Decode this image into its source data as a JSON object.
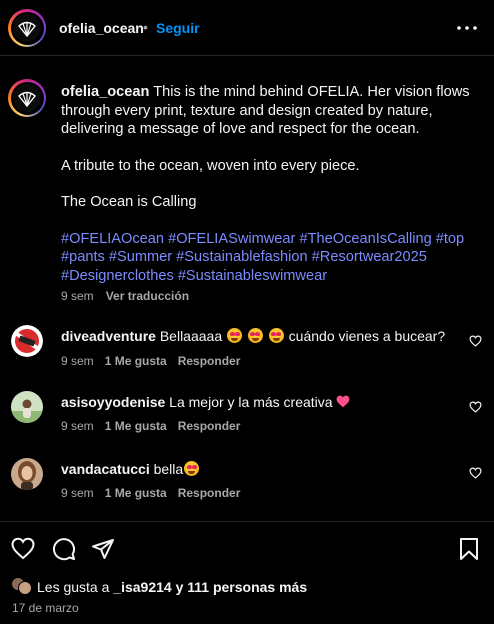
{
  "header": {
    "username": "ofelia_ocean",
    "separator": "•",
    "follow_label": "Seguir",
    "more_icon": "more-horizontal-icon"
  },
  "caption": {
    "username": "ofelia_ocean",
    "text_1": "This is the mind behind OFELIA. Her vision flows through every print, texture and design created by nature, delivering a message of love and respect for the ocean.",
    "text_2": "A tribute to the ocean, woven into every piece.",
    "text_3": "The Ocean is Calling",
    "hashtags": "#OFELIAOcean #OFELIASwimwear #TheOceanIsCalling #top #pants #Summer #Sustainablefashion #Resortwear2025 #Designerclothes #Sustainableswimwear",
    "age": "9 sem",
    "translate_label": "Ver traducción"
  },
  "comments": [
    {
      "username": "diveadventure",
      "text_before": "Bellaaaaa",
      "text_after": "cuándo vienes a bucear?",
      "emoji": "heart-eyes-emoji",
      "age": "9 sem",
      "likes": "1 Me gusta",
      "reply_label": "Responder"
    },
    {
      "username": "asisoyyodenise",
      "text": "La mejor y la más creativa",
      "emoji": "pink-heart-emoji",
      "age": "9 sem",
      "likes": "1 Me gusta",
      "reply_label": "Responder"
    },
    {
      "username": "vandacatucci",
      "text": "bella",
      "emoji": "heart-eyes-emoji",
      "age": "9 sem",
      "likes": "1 Me gusta",
      "reply_label": "Responder"
    }
  ],
  "actions": {
    "like_icon": "heart-icon",
    "comment_icon": "comment-icon",
    "share_icon": "share-icon",
    "save_icon": "bookmark-icon"
  },
  "likes": {
    "prefix": "Les gusta a",
    "user": "_isa9214",
    "connector": "y",
    "others": "111 personas más"
  },
  "date": "17 de marzo",
  "colors": {
    "background": "#000000",
    "text": "#f5f5f5",
    "secondary": "#a8a8a8",
    "accent": "#0095f6",
    "hashtag": "#7b8cff",
    "divider": "#262626"
  }
}
